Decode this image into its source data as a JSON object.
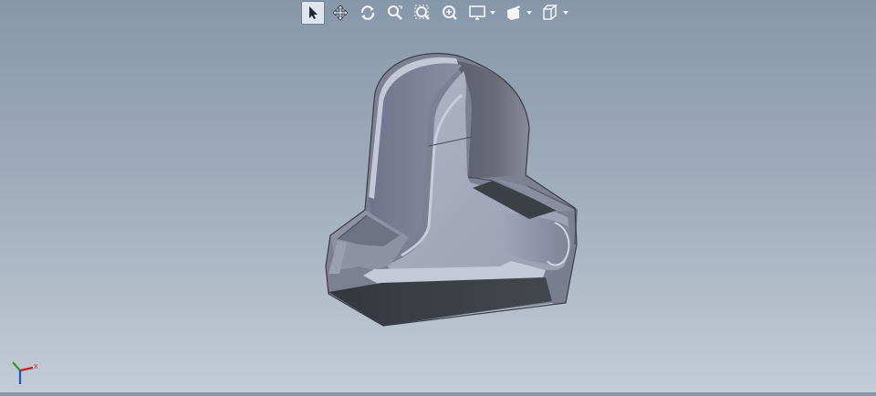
{
  "toolbar": {
    "buttons": [
      {
        "icon": "select-arrow-icon",
        "active": true
      },
      {
        "icon": "pan-icon",
        "active": false
      },
      {
        "icon": "rotate-icon",
        "active": false
      },
      {
        "icon": "zoom-to-fit-icon",
        "active": false
      },
      {
        "icon": "zoom-to-area-icon",
        "active": false
      },
      {
        "icon": "zoom-in-out-icon",
        "active": false
      },
      {
        "icon": "display-style-icon",
        "active": false,
        "has_dropdown": true
      },
      {
        "icon": "appearance-icon",
        "active": false,
        "has_dropdown": true
      },
      {
        "icon": "view-orientation-icon",
        "active": false,
        "has_dropdown": true
      }
    ]
  },
  "viewport": {
    "model": "cut-section-part",
    "background_top": "#8797aa",
    "background_bottom": "#c3cbd6"
  },
  "triad": {
    "axis_x_label": "X",
    "axis_y_label": "Y",
    "axis_z_label": "Z",
    "x_color": "#d02020",
    "y_color": "#2e9a2e",
    "z_color": "#2050c8"
  }
}
